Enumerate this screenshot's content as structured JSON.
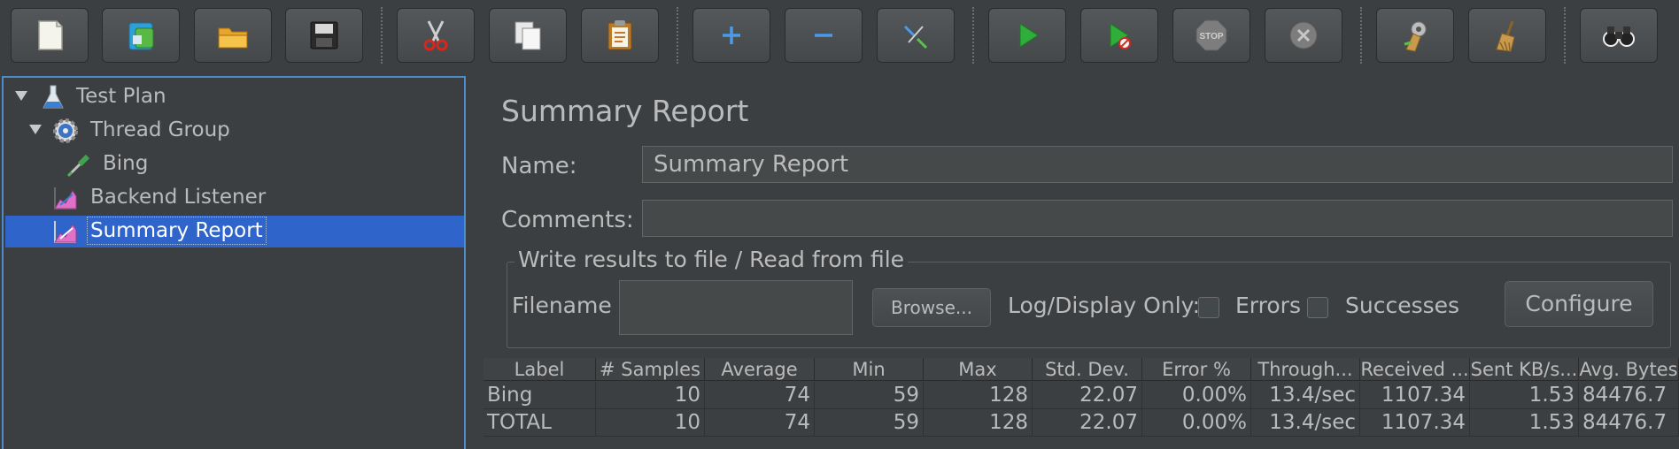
{
  "toolbar": {
    "buttons": [
      {
        "name": "new-button",
        "icon": "new-file-icon"
      },
      {
        "name": "templates-button",
        "icon": "templates-icon"
      },
      {
        "name": "open-button",
        "icon": "open-folder-icon"
      },
      {
        "name": "save-button",
        "icon": "save-disk-icon"
      },
      {
        "name": "cut-button",
        "icon": "scissors-icon"
      },
      {
        "name": "copy-button",
        "icon": "copy-icon"
      },
      {
        "name": "paste-button",
        "icon": "clipboard-icon"
      },
      {
        "name": "expand-all-button",
        "icon": "plus-icon"
      },
      {
        "name": "collapse-all-button",
        "icon": "minus-icon"
      },
      {
        "name": "toggle-button",
        "icon": "toggle-wand-icon"
      },
      {
        "name": "start-button",
        "icon": "play-icon"
      },
      {
        "name": "start-no-pauses-button",
        "icon": "play-no-timers-icon"
      },
      {
        "name": "stop-button",
        "icon": "stop-sign-icon",
        "label": "STOP"
      },
      {
        "name": "shutdown-button",
        "icon": "shutdown-icon"
      },
      {
        "name": "clear-button",
        "icon": "broom-gear-icon"
      },
      {
        "name": "clear-all-button",
        "icon": "broom-icon"
      },
      {
        "name": "search-button",
        "icon": "binoculars-icon"
      }
    ]
  },
  "tree": {
    "items": [
      {
        "label": "Test Plan",
        "icon": "flask-icon",
        "expanded": true
      },
      {
        "label": "Thread Group",
        "icon": "gear-icon",
        "expanded": true
      },
      {
        "label": "Bing",
        "icon": "pipette-icon"
      },
      {
        "label": "Backend Listener",
        "icon": "listener-graph-icon"
      },
      {
        "label": "Summary Report",
        "icon": "listener-graph-icon",
        "selected": true
      }
    ]
  },
  "main": {
    "title": "Summary Report",
    "name_label": "Name:",
    "name_value": "Summary Report",
    "comments_label": "Comments:",
    "comments_value": "",
    "file_group": {
      "legend": "Write results to file / Read from file",
      "filename_label": "Filename",
      "filename_value": "",
      "browse_label": "Browse...",
      "log_label": "Log/Display Only:",
      "errors_label": "Errors",
      "errors_checked": false,
      "successes_label": "Successes",
      "successes_checked": false,
      "configure_label": "Configure"
    }
  },
  "table": {
    "columns": [
      "Label",
      "# Samples",
      "Average",
      "Min",
      "Max",
      "Std. Dev.",
      "Error %",
      "Through...",
      "Received ...",
      "Sent KB/s...",
      "Avg. Bytes"
    ],
    "rows": [
      [
        "Bing",
        "10",
        "74",
        "59",
        "128",
        "22.07",
        "0.00%",
        "13.4/sec",
        "1107.34",
        "1.53",
        "84476.7"
      ],
      [
        "TOTAL",
        "10",
        "74",
        "59",
        "128",
        "22.07",
        "0.00%",
        "13.4/sec",
        "1107.34",
        "1.53",
        "84476.7"
      ]
    ]
  },
  "colors": {
    "background": "#3c3f41",
    "selection": "#2f65ca",
    "focus_border": "#4b8cc9",
    "text": "#bbbbbb"
  }
}
